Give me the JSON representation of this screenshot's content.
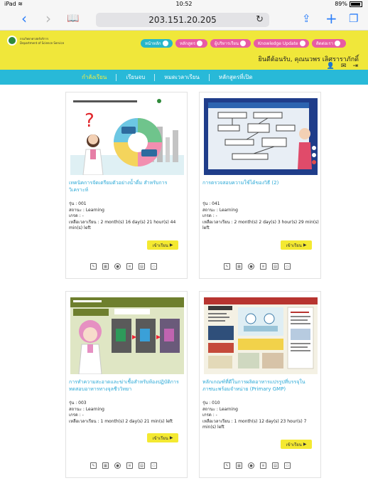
{
  "status_bar": {
    "device": "iPad",
    "wifi": "wifi-icon",
    "time": "10:52",
    "battery": "89%"
  },
  "browser": {
    "url": "203.151.20.205",
    "icons": [
      "back-arrow-icon",
      "forward-arrow-icon",
      "bookmarks-book-icon",
      "reload-icon",
      "share-icon",
      "new-tab-plus-icon",
      "tabs-icon"
    ]
  },
  "header": {
    "org_th": "กรมวิทยาศาสตร์บริการ",
    "org_en": "Department of Science Service",
    "nav": [
      {
        "label": "หน้าหลัก",
        "color": "#27b6c9"
      },
      {
        "label": "หลักสูตร",
        "color": "#e85ba3"
      },
      {
        "label": "ผู้บริหารเรียน",
        "color": "#e85ba3"
      },
      {
        "label": "Knowledge Update",
        "color": "#e85ba3"
      },
      {
        "label": "ติดต่อเรา",
        "color": "#e85ba3"
      }
    ],
    "welcome": "ยินดีต้อนรับ, คุณนวพร เลิศราราภักดิ์"
  },
  "tabs": [
    {
      "label": "กำลังเรียน",
      "active": true
    },
    {
      "label": "เรียนจบ",
      "active": false
    },
    {
      "label": "หมดเวลาเรียน",
      "active": false
    },
    {
      "label": "หลักสูตรที่เปิด",
      "active": false
    }
  ],
  "courses": [
    {
      "title": "เทคนิคการจัดเตรียมตัวอย่างน้ำดื่ม สำหรับการวิเคราะห์",
      "code": "รุ่น : 001",
      "status": "สถานะ : Learning",
      "grade": "เกรด : -",
      "remaining": "เหลือเวลาเรียน : 2 month(s) 16 day(s) 21 hour(s) 44 min(s) left",
      "button": "เข้าเรียน"
    },
    {
      "title": "การตรวจสอบความใช้ได้ของวิธี (2)",
      "code": "รุ่น : 041",
      "status": "สถานะ : Learning",
      "grade": "เกรด : -",
      "remaining": "เหลือเวลาเรียน : 2 month(s) 2 day(s) 3 hour(s) 29 min(s) left",
      "button": "เข้าเรียน"
    },
    {
      "title": "การทำความสะอาดและฆ่าเชื้อสำหรับห้องปฏิบัติการทดสอบอาหารทางจุลชีววิทยา",
      "code": "รุ่น : 003",
      "status": "สถานะ : Learning",
      "grade": "เกรด : -",
      "remaining": "เหลือเวลาเรียน : 1 month(s) 2 day(s) 21 min(s) left",
      "button": "เข้าเรียน"
    },
    {
      "title": "หลักเกณฑ์ที่ดีในการผลิตอาหารแปรรูปที่บรรจุในภาชนะพร้อมจำหน่าย (Primary GMP)",
      "code": "รุ่น : 010",
      "status": "สถานะ : Learning",
      "grade": "เกรด : -",
      "remaining": "เหลือเวลาเรียน : 1 month(s) 12 day(s) 23 hour(s) 7 min(s) left",
      "button": "เข้าเรียน"
    }
  ],
  "card_icons": [
    "edit-icon",
    "calendar-icon",
    "webcam-icon",
    "document-icon",
    "book-icon",
    "chat-icon"
  ]
}
